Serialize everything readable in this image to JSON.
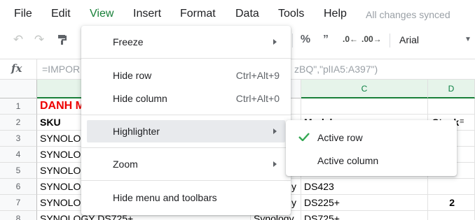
{
  "menubar": {
    "items": [
      "File",
      "Edit",
      "View",
      "Insert",
      "Format",
      "Data",
      "Tools",
      "Help"
    ],
    "active_item": "View",
    "status": "All changes synced"
  },
  "toolbar": {
    "undo_icon": "undo-icon",
    "redo_icon": "redo-icon",
    "paint_format_icon": "paint-format-icon",
    "percent": "%",
    "decimal_decrease": ".0←",
    "decimal_increase": ".00→",
    "format_more": "”",
    "font": "Arial"
  },
  "formula_bar": {
    "fx": "fx",
    "text_left": "=IMPOR",
    "text_right": "zBQ\",\"plIA5:A397\")"
  },
  "grid": {
    "col_headers": [
      "C",
      "D"
    ],
    "rows": [
      {
        "num": "1",
        "a": "DANH M",
        "c": "",
        "d": ""
      },
      {
        "num": "2",
        "a": "SKU",
        "c": "Model",
        "d": "Stock"
      },
      {
        "num": "3",
        "a": "SYNOLO",
        "c": "",
        "d": ""
      },
      {
        "num": "4",
        "a": "SYNOLO",
        "c": "",
        "d": ""
      },
      {
        "num": "5",
        "a": "SYNOLO",
        "c": "",
        "d": ""
      },
      {
        "num": "6",
        "a": "SYNOLO",
        "b": "y",
        "c": "DS423",
        "d": ""
      },
      {
        "num": "7",
        "a": "SYNOLO",
        "b": "y",
        "c": "DS225+",
        "d": "2"
      },
      {
        "num": "8",
        "a": "SYNOLOGY DS725+",
        "b": "Synology",
        "c": "DS725+",
        "d": ""
      }
    ]
  },
  "view_menu": {
    "items": [
      {
        "label": "Freeze",
        "shortcut": "",
        "submenu": true
      },
      {
        "label": "Hide row",
        "shortcut": "Ctrl+Alt+9",
        "submenu": false
      },
      {
        "label": "Hide column",
        "shortcut": "Ctrl+Alt+0",
        "submenu": false
      },
      {
        "label": "Highlighter",
        "shortcut": "",
        "submenu": true
      },
      {
        "label": "Zoom",
        "shortcut": "",
        "submenu": true
      },
      {
        "label": "Hide menu and toolbars",
        "shortcut": "",
        "submenu": false
      }
    ]
  },
  "highlighter_submenu": {
    "items": [
      {
        "label": "Active row",
        "checked": true
      },
      {
        "label": "Active column",
        "checked": false
      }
    ],
    "accent_color": "#34a853"
  }
}
